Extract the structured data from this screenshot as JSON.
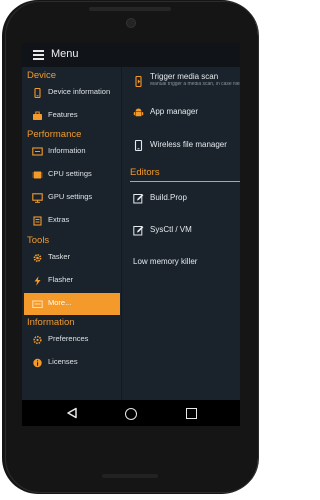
{
  "header": {
    "title": "Menu"
  },
  "drawer": {
    "sections": [
      {
        "title": "Device",
        "items": [
          {
            "label": "Device information",
            "icon": "phone-icon"
          },
          {
            "label": "Features",
            "icon": "briefcase-icon"
          }
        ]
      },
      {
        "title": "Performance",
        "items": [
          {
            "label": "Information",
            "icon": "monitor-info-icon"
          },
          {
            "label": "CPU settings",
            "icon": "cpu-icon"
          },
          {
            "label": "GPU settings",
            "icon": "display-icon"
          },
          {
            "label": "Extras",
            "icon": "wrench-icon"
          }
        ]
      },
      {
        "title": "Tools",
        "items": [
          {
            "label": "Tasker",
            "icon": "gear-icon"
          },
          {
            "label": "Flasher",
            "icon": "lightning-icon"
          },
          {
            "label": "More...",
            "icon": "toolbox-icon",
            "selected": true
          }
        ]
      },
      {
        "title": "Information",
        "items": [
          {
            "label": "Preferences",
            "icon": "settings-icon"
          },
          {
            "label": "Licenses",
            "icon": "info-icon"
          }
        ]
      }
    ]
  },
  "content": {
    "items": [
      {
        "title": "Trigger media scan",
        "desc": "Manual trigger a media scan, in case files are not shown via MTP and new files are not visible",
        "icon": "media-scan-icon"
      },
      {
        "title": "App manager",
        "icon": "android-icon"
      },
      {
        "title": "Wireless file manager",
        "icon": "wireless-phone-icon"
      }
    ],
    "editors_title": "Editors",
    "editors": [
      {
        "title": "Build.Prop",
        "icon": "edit-icon"
      },
      {
        "title": "SysCtl / VM",
        "icon": "edit-icon"
      },
      {
        "title": "Low memory killer",
        "icon": ""
      }
    ]
  },
  "accent_color": "#f39a2b",
  "background_color": "#1c252e"
}
